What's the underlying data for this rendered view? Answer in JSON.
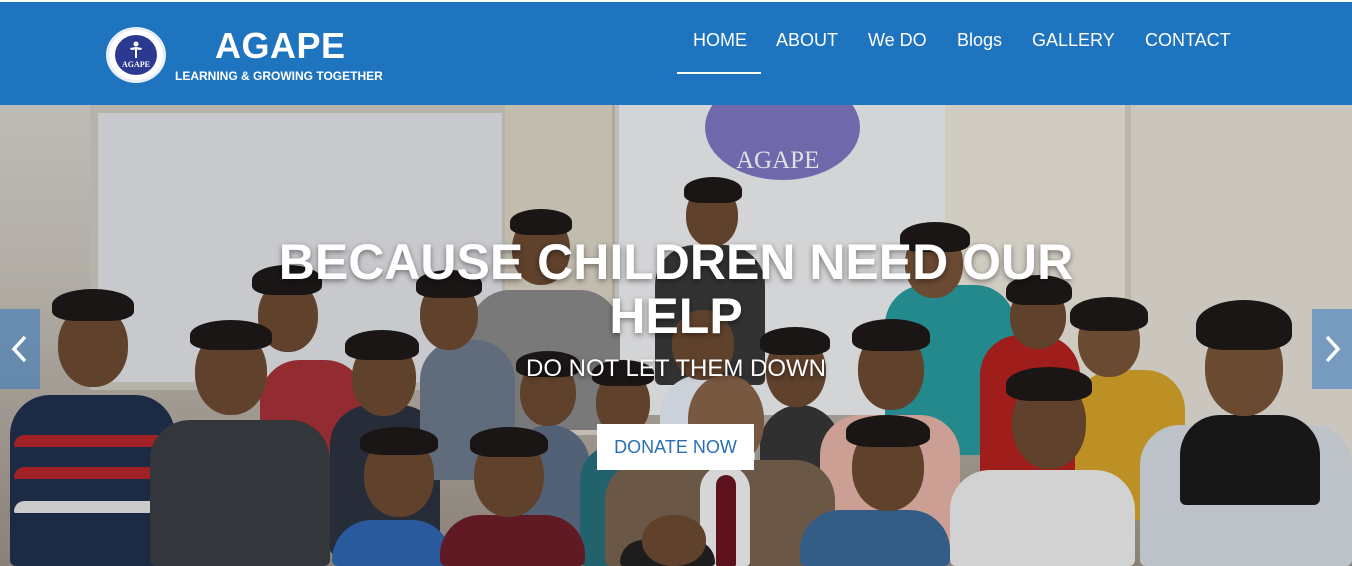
{
  "brand": {
    "name": "AGAPE",
    "tagline": "LEARNING & GROWING TOGETHER",
    "logo_text": "AGAPE",
    "logo_icon": "tree-people-icon"
  },
  "nav": {
    "items": [
      {
        "label": "HOME",
        "active": true
      },
      {
        "label": "ABOUT"
      },
      {
        "label": "We DO"
      },
      {
        "label": "Blogs"
      },
      {
        "label": "GALLERY"
      },
      {
        "label": "CONTACT"
      }
    ]
  },
  "hero": {
    "banner_word": "AGAPE",
    "title": "BECAUSE CHILDREN NEED OUR HELP",
    "subtitle": "DO NOT LET THEM DOWN",
    "donate_label": "DONATE NOW",
    "prev_icon": "chevron-left-icon",
    "next_icon": "chevron-right-icon"
  },
  "colors": {
    "navbar": "#1f74c0",
    "button_text": "#2a6fb5",
    "white": "#ffffff"
  }
}
